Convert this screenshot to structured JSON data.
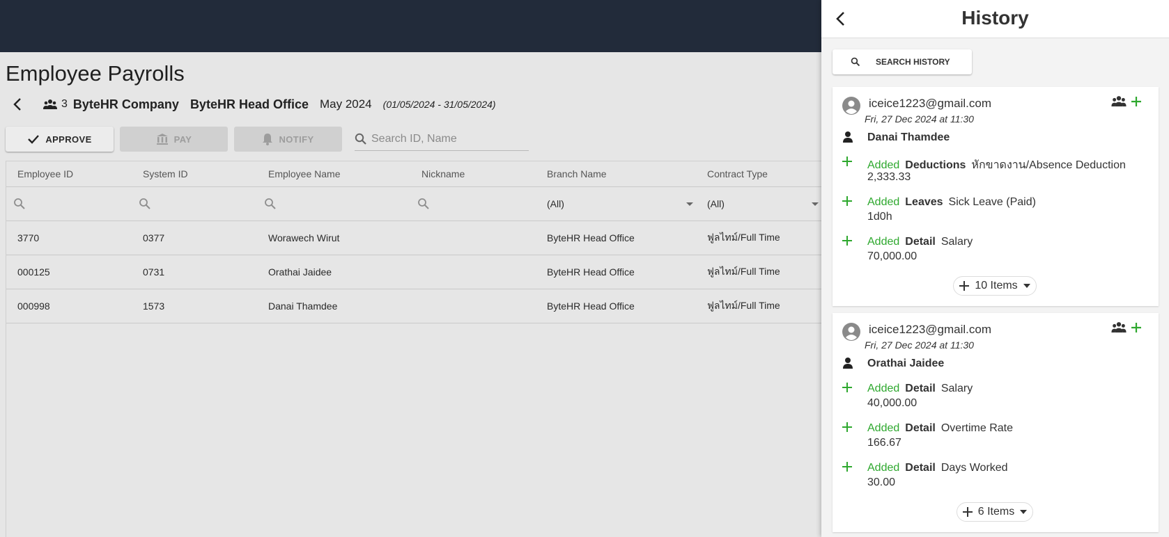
{
  "page": {
    "title": "Employee Payrolls",
    "headcount": "3",
    "company": "ByteHR Company",
    "office": "ByteHR Head Office",
    "period": "May 2024",
    "range": "(01/05/2024 - 31/05/2024)"
  },
  "actions": {
    "approve": "APPROVE",
    "pay": "PAY",
    "notify": "NOTIFY",
    "search_placeholder": "Search ID, Name"
  },
  "table": {
    "columns": [
      "Employee ID",
      "System ID",
      "Employee Name",
      "Nickname",
      "Branch Name",
      "Contract Type"
    ],
    "filters": {
      "branch": "(All)",
      "contract": "(All)"
    },
    "rows": [
      {
        "employee_id": "3770",
        "system_id": "0377",
        "name": "Worawech Wirut",
        "nickname": "",
        "branch": "ByteHR Head Office",
        "contract": "ฟูลไทม์/Full Time"
      },
      {
        "employee_id": "000125",
        "system_id": "0731",
        "name": "Orathai Jaidee",
        "nickname": "",
        "branch": "ByteHR Head Office",
        "contract": "ฟูลไทม์/Full Time"
      },
      {
        "employee_id": "000998",
        "system_id": "1573",
        "name": "Danai Thamdee",
        "nickname": "",
        "branch": "ByteHR Head Office",
        "contract": "ฟูลไทม์/Full Time"
      }
    ]
  },
  "history": {
    "title": "History",
    "search_label": "SEARCH HISTORY",
    "cards": [
      {
        "email": "iceice1223@gmail.com",
        "time": "Fri, 27 Dec 2024 at 11:30",
        "person": "Danai Thamdee",
        "entries": [
          {
            "action": "Added",
            "category": "Deductions",
            "item": "หักขาดงาน/Absence Deduction",
            "value": "2,333.33"
          },
          {
            "action": "Added",
            "category": "Leaves",
            "item": "Sick Leave (Paid)",
            "value": "1d0h"
          },
          {
            "action": "Added",
            "category": "Detail",
            "item": "Salary",
            "value": "70,000.00"
          }
        ],
        "more": "10 Items"
      },
      {
        "email": "iceice1223@gmail.com",
        "time": "Fri, 27 Dec 2024 at 11:30",
        "person": "Orathai Jaidee",
        "entries": [
          {
            "action": "Added",
            "category": "Detail",
            "item": "Salary",
            "value": "40,000.00"
          },
          {
            "action": "Added",
            "category": "Detail",
            "item": "Overtime Rate",
            "value": "166.67"
          },
          {
            "action": "Added",
            "category": "Detail",
            "item": "Days Worked",
            "value": "30.00"
          }
        ],
        "more": "6 Items"
      }
    ]
  },
  "colors": {
    "topbar": "#222b3a",
    "added": "#2ea82e"
  }
}
